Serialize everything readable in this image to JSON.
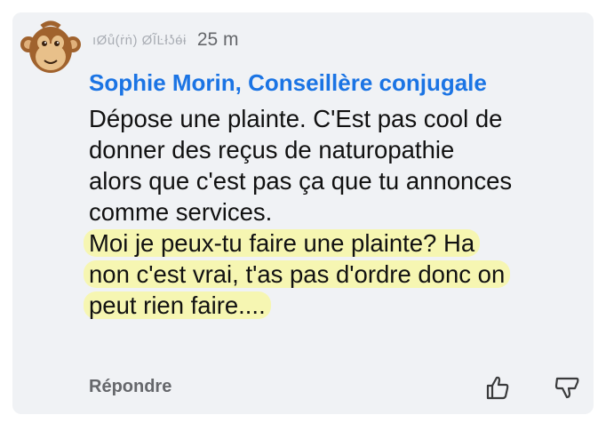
{
  "comment": {
    "avatar_icon": "monkey-avatar-icon",
    "handle": "ıØů(ṙṅ) ØĨĿłʖ́ɵ́ɨ",
    "time": "25 m",
    "author": "Sophie Morin, Conseillère conjugale",
    "lines": [
      "Dépose une plainte. C'Est pas cool de",
      "donner des reçus de naturopathie",
      "alors que c'est pas ça que tu annonces",
      "comme services."
    ],
    "highlighted_lines": [
      "Moi je peux-tu faire une plainte? Ha",
      "non c'est vrai, t'as pas d'ordre donc on",
      "peut rien faire...."
    ],
    "highlight_color": "#f6f6b2"
  },
  "actions": {
    "reply_label": "Répondre",
    "upvote_icon": "thumbs-up-icon",
    "downvote_icon": "thumbs-down-icon"
  },
  "colors": {
    "author": "#1b74e4",
    "bubble": "#f0f2f5",
    "muted": "#65676b"
  }
}
